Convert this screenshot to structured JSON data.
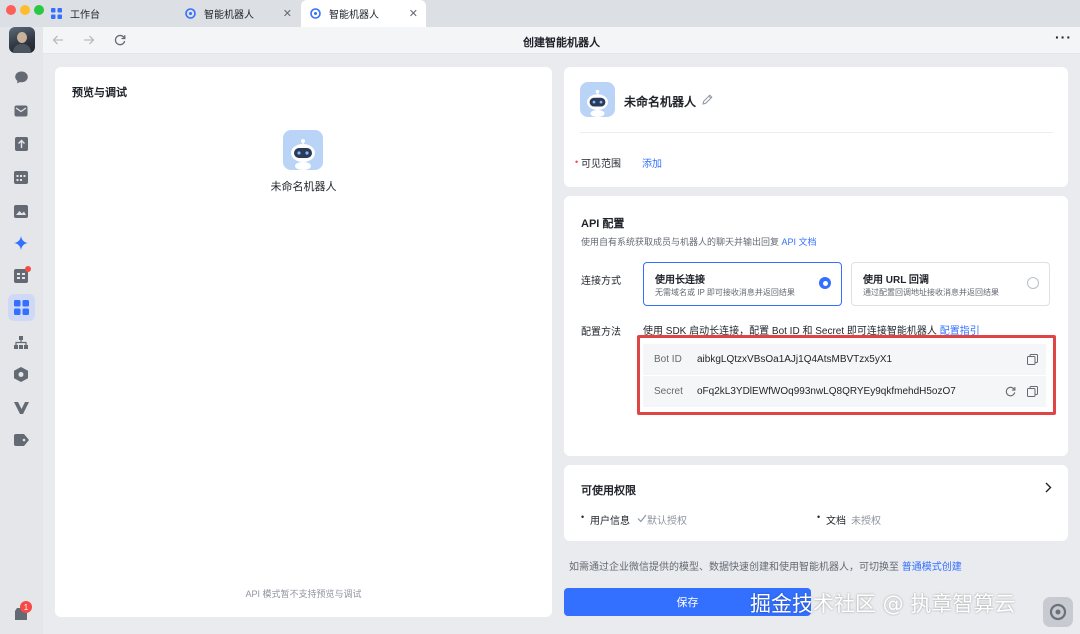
{
  "colors": {
    "accent": "#3370ff",
    "highlight_box": "#e04545",
    "notify_red": "#f54a45"
  },
  "tabs": [
    {
      "label": "工作台",
      "icon": "grid-icon"
    },
    {
      "label": "智能机器人",
      "icon": "bot-logo-icon"
    },
    {
      "label": "智能机器人",
      "icon": "bot-logo-icon",
      "active": true
    }
  ],
  "sidebar": {
    "items": [
      {
        "icon": "chat-icon"
      },
      {
        "icon": "mail-icon"
      },
      {
        "icon": "upload-icon"
      },
      {
        "icon": "calendar-icon"
      },
      {
        "icon": "image-icon"
      },
      {
        "icon": "sparkle-icon"
      },
      {
        "icon": "approval-icon",
        "badge_dot": true
      },
      {
        "icon": "workplace-icon",
        "active": true
      },
      {
        "icon": "org-chart-icon"
      },
      {
        "icon": "hexagon-icon"
      },
      {
        "icon": "v-logo-icon"
      },
      {
        "icon": "tag-icon"
      }
    ],
    "bottom_badge": "1"
  },
  "toolbar": {
    "title": "创建智能机器人",
    "more": "···"
  },
  "preview": {
    "title": "预览与调试",
    "bot_name": "未命名机器人",
    "footer_note": "API 模式暂不支持预览与调试"
  },
  "bot_info": {
    "name": "未命名机器人",
    "visibility_label": "可见范围",
    "visibility_action": "添加"
  },
  "api_config": {
    "title": "API 配置",
    "description": "使用自有系统获取成员与机器人的聊天并输出回复",
    "doc_link": "API 文档",
    "connection_label": "连接方式",
    "options": [
      {
        "title": "使用长连接",
        "desc": "无需域名或 IP 即可接收消息并返回结果",
        "selected": true
      },
      {
        "title": "使用 URL 回调",
        "desc": "通过配置回调地址接收消息并返回结果",
        "selected": false
      }
    ],
    "method_label": "配置方法",
    "method_text": "使用 SDK 启动长连接，配置 Bot ID 和 Secret 即可连接智能机器人",
    "method_link": "配置指引",
    "bot_id_label": "Bot ID",
    "bot_id_value": "aibkgLQtzxVBsOa1AJj1Q4AtsMBVTzx5yX1",
    "secret_label": "Secret",
    "secret_value": "oFq2kL3YDlEWfWOq993nwLQ8QRYEy9qkfmehdH5ozO7"
  },
  "permissions": {
    "title": "可使用权限",
    "user_info_label": "用户信息",
    "user_info_status": "默认授权",
    "docs_label": "文档",
    "docs_status": "未授权"
  },
  "footer": {
    "note": "如需通过企业微信提供的模型、数据快速创建和使用智能机器人，可切换至",
    "switch_link": "普通模式创建",
    "save_label": "保存"
  },
  "watermark": "掘金技术社区 @ 执章智算云"
}
